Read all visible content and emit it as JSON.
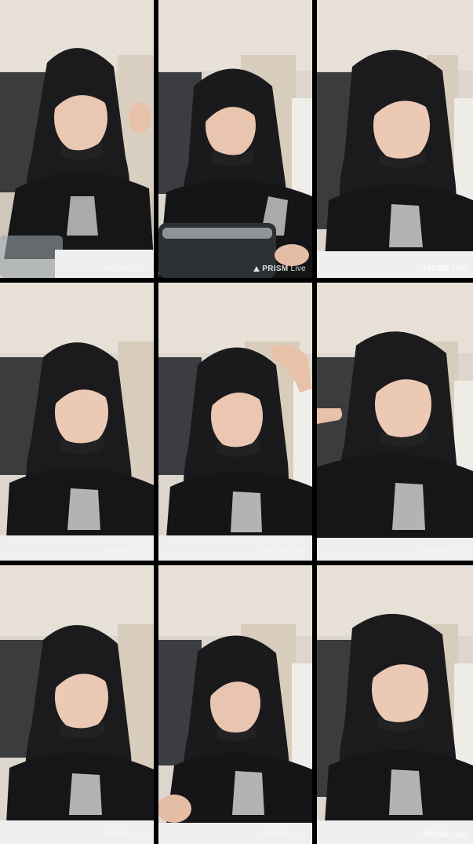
{
  "watermark": {
    "brand": "PRISM",
    "suffix": "Live"
  },
  "frames": [
    {
      "id": 1,
      "pose": "talking",
      "extra": "phone-case-bottom-left",
      "hand": "raised-right"
    },
    {
      "id": 2,
      "pose": "looking-down",
      "extra": "phone-case-bottom",
      "hand": "bottom-right"
    },
    {
      "id": 3,
      "pose": "talking",
      "extra": "none",
      "hand": "none"
    },
    {
      "id": 4,
      "pose": "talking",
      "extra": "none",
      "hand": "none"
    },
    {
      "id": 5,
      "pose": "talking",
      "extra": "none",
      "hand": "touching-hair"
    },
    {
      "id": 6,
      "pose": "smiling",
      "extra": "none",
      "hand": "pointing-left"
    },
    {
      "id": 7,
      "pose": "talking",
      "extra": "none",
      "hand": "none"
    },
    {
      "id": 8,
      "pose": "looking-down",
      "extra": "none",
      "hand": "bottom-left"
    },
    {
      "id": 9,
      "pose": "smiling",
      "extra": "none",
      "hand": "none"
    }
  ]
}
